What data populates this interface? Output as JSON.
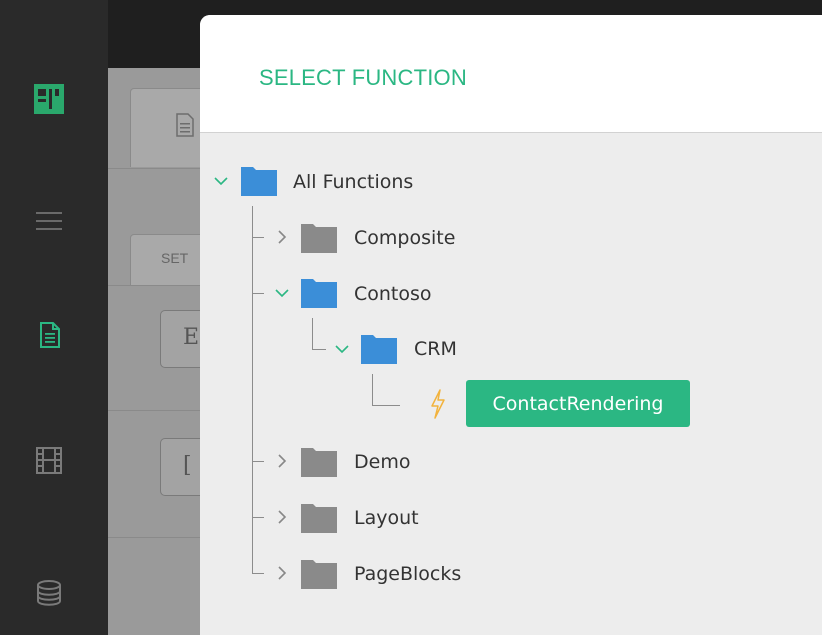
{
  "dialog": {
    "title": "SELECT FUNCTION"
  },
  "background": {
    "tab_label": "SET"
  },
  "tree": {
    "root": "All Functions",
    "items": {
      "composite": "Composite",
      "contoso": "Contoso",
      "crm": "CRM",
      "function": "ContactRendering",
      "demo": "Demo",
      "layout": "Layout",
      "pageblocks": "PageBlocks"
    }
  },
  "colors": {
    "accent": "#2bb783",
    "folder_open": "#3b8ed8",
    "folder_closed": "#8a8a8a",
    "lightning": "#f2b33d"
  },
  "icons": {
    "sidebar": [
      "logo-icon",
      "menu-icon",
      "document-icon",
      "film-icon",
      "database-icon"
    ]
  }
}
